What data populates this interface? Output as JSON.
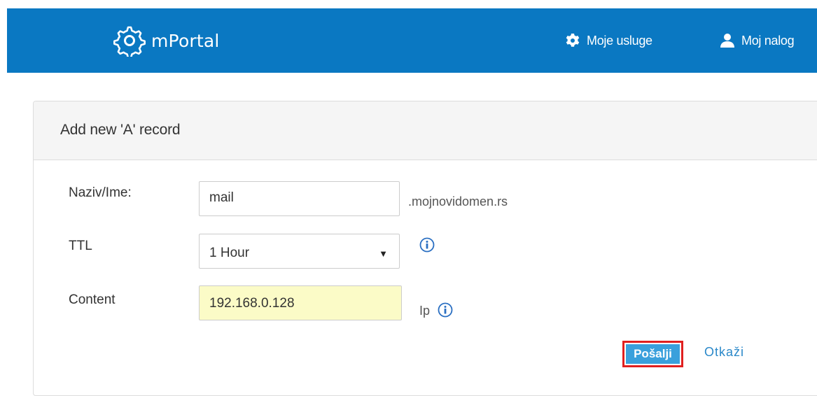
{
  "header": {
    "app_name": "mPortal",
    "nav": {
      "services_label": "Moje usluge",
      "account_label": "Moj nalog"
    },
    "icons": {
      "logo": "gear-outline-logo-icon",
      "services": "gear-icon",
      "account": "user-icon"
    },
    "colors": {
      "bar": "#0a78c2"
    }
  },
  "form": {
    "title": "Add new 'A' record",
    "name": {
      "label": "Naziv/Ime:",
      "value": "mail",
      "suffix": ".mojnovidomen.rs"
    },
    "ttl": {
      "label": "TTL",
      "selected": "1 Hour",
      "arrow": "▼",
      "info_icon": "info-circle-icon"
    },
    "content": {
      "label": "Content",
      "value": "192.168.0.128",
      "unit": "Ip",
      "info_icon": "info-circle-icon"
    },
    "actions": {
      "submit_label": "Pošalji",
      "cancel_label": "Otkaži"
    },
    "colors": {
      "submit_bg": "#3aa0dc",
      "submit_highlight_border": "#e0201f",
      "content_field_bg": "#fbfbc7",
      "link": "#2a88c9"
    }
  }
}
